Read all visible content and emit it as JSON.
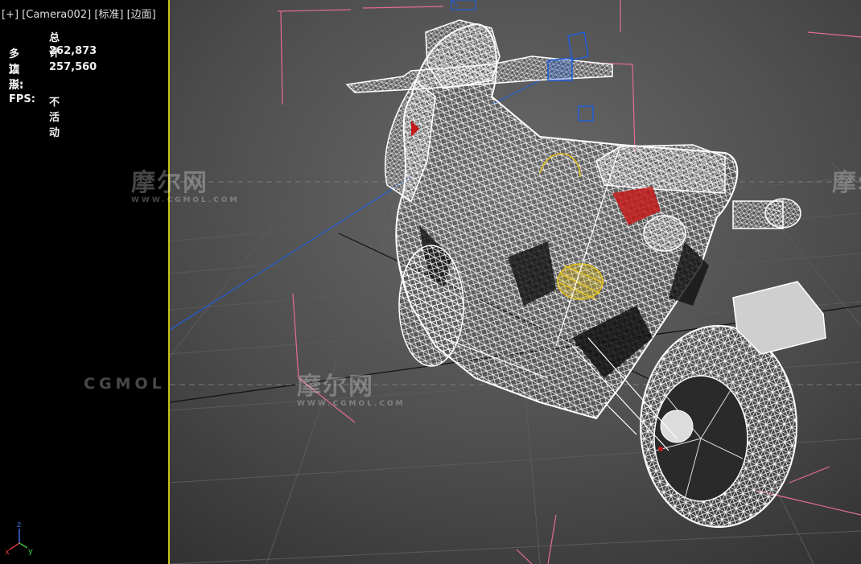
{
  "viewport": {
    "plus_label": "[+]",
    "camera_label": "[Camera002]",
    "shading_label": "[标准]",
    "display_label": "[边面]"
  },
  "stats": {
    "header": "总计",
    "polygons_label": "多边形:",
    "polygons_value": "262,873",
    "vertices_label": "顶点:",
    "vertices_value": "257,560",
    "fps_label": "FPS:",
    "fps_value": "不活动"
  },
  "watermarks": {
    "logo_text": "摩尔网",
    "logo_sub": "WWW.CGMOL.COM",
    "brand_text": "CGMOL"
  },
  "axis_gizmo": {
    "z": "z",
    "x": "x",
    "y": "y"
  },
  "colors": {
    "panel_border": "#c9c218",
    "grid_line": "#555555",
    "bounding_box": "#e46b9a",
    "wireframe": "#ffffff",
    "selection_blue": "#1f5ed8",
    "yellow_highlight": "#e5c21a",
    "red_accent": "#c41a1a"
  }
}
